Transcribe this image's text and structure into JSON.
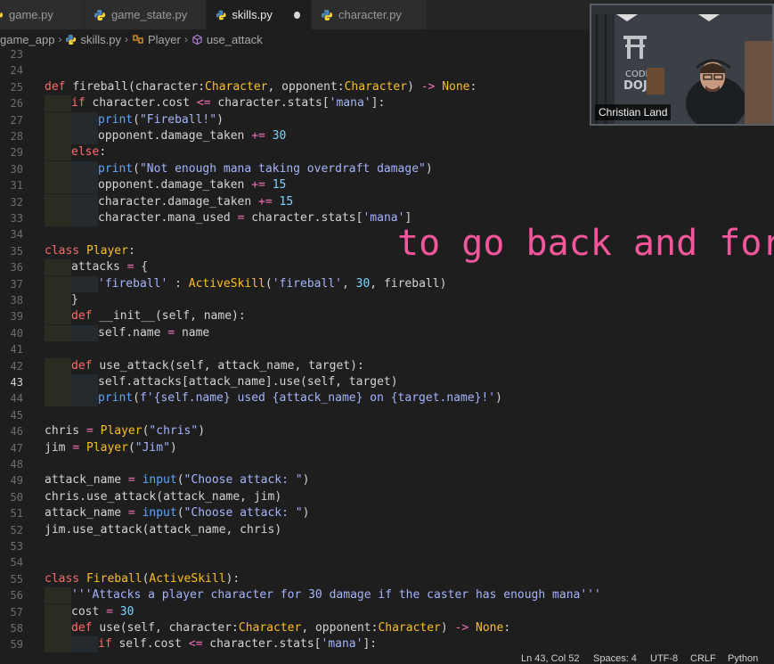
{
  "tabs": [
    {
      "label": "game.py",
      "active": false
    },
    {
      "label": "game_state.py",
      "active": false
    },
    {
      "label": "skills.py",
      "active": true,
      "modified": true
    },
    {
      "label": "character.py",
      "active": false
    }
  ],
  "breadcrumb": [
    "game_app",
    "skills.py",
    "Player",
    "use_attack"
  ],
  "caption": "to go back and for",
  "webcam": {
    "name": "Christian Land",
    "sign_line1": "CODING",
    "sign_line2": "DOJO"
  },
  "status": {
    "position": "Ln 43, Col 52",
    "spaces": "Spaces: 4",
    "encoding": "UTF-8",
    "eol": "CRLF",
    "language": "Python"
  },
  "colors": {
    "caption": "#f3569a",
    "editor_bg": "#1e1e1e"
  },
  "code": {
    "current_line": "43",
    "lines": [
      {
        "n": "23",
        "t": ""
      },
      {
        "n": "24",
        "t": ""
      },
      {
        "n": "25",
        "t": "def fireball(character:Character, opponent:Character) -> None:"
      },
      {
        "n": "26",
        "t": "if character.cost <= character.stats['mana']:"
      },
      {
        "n": "27",
        "t": "print(\"Fireball!\")"
      },
      {
        "n": "28",
        "t": "opponent.damage_taken += 30"
      },
      {
        "n": "29",
        "t": "else:"
      },
      {
        "n": "30",
        "t": "print(\"Not enough mana taking overdraft damage\")"
      },
      {
        "n": "31",
        "t": "opponent.damage_taken += 15"
      },
      {
        "n": "32",
        "t": "character.damage_taken += 15"
      },
      {
        "n": "33",
        "t": "character.mana_used = character.stats['mana']"
      },
      {
        "n": "34",
        "t": ""
      },
      {
        "n": "35",
        "t": "class Player:"
      },
      {
        "n": "36",
        "t": "attacks = {"
      },
      {
        "n": "37",
        "t": "'fireball' : ActiveSkill('fireball', 30, fireball)"
      },
      {
        "n": "38",
        "t": "}"
      },
      {
        "n": "39",
        "t": "def __init__(self, name):"
      },
      {
        "n": "40",
        "t": "self.name = name"
      },
      {
        "n": "41",
        "t": ""
      },
      {
        "n": "42",
        "t": "def use_attack(self, attack_name, target):"
      },
      {
        "n": "43",
        "t": "self.attacks[attack_name].use(self, target)"
      },
      {
        "n": "44",
        "t": "print(f'{self.name} used {attack_name} on {target.name}!')"
      },
      {
        "n": "45",
        "t": ""
      },
      {
        "n": "46",
        "t": "chris = Player(\"chris\")"
      },
      {
        "n": "47",
        "t": "jim = Player(\"Jim\")"
      },
      {
        "n": "48",
        "t": ""
      },
      {
        "n": "49",
        "t": "attack_name = input(\"Choose attack: \")"
      },
      {
        "n": "50",
        "t": "chris.use_attack(attack_name, jim)"
      },
      {
        "n": "51",
        "t": "attack_name = input(\"Choose attack: \")"
      },
      {
        "n": "52",
        "t": "jim.use_attack(attack_name, chris)"
      },
      {
        "n": "53",
        "t": ""
      },
      {
        "n": "54",
        "t": ""
      },
      {
        "n": "55",
        "t": "class Fireball(ActiveSkill):"
      },
      {
        "n": "56",
        "t": "'''Attacks a player character for 30 damage if the caster has enough mana'''"
      },
      {
        "n": "57",
        "t": "cost = 30"
      },
      {
        "n": "58",
        "t": "def use(self, character:Character, opponent:Character) -> None:"
      },
      {
        "n": "59",
        "t": "if self.cost <= character.stats['mana']:"
      }
    ]
  }
}
